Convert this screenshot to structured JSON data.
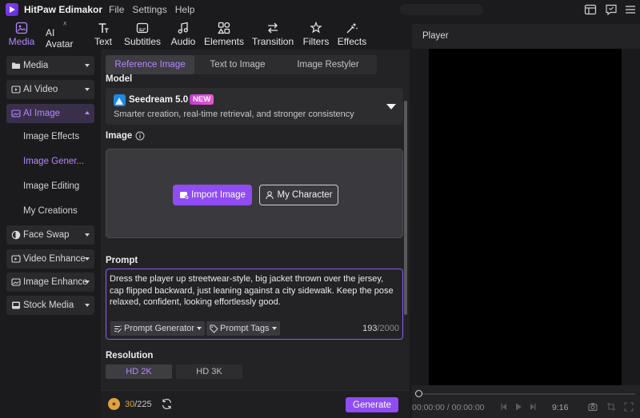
{
  "app": {
    "title": "HitPaw Edimakor",
    "menu": [
      "File",
      "Settings",
      "Help"
    ]
  },
  "tool_tabs": [
    {
      "label": "Media",
      "icon": "media-icon",
      "active": true
    },
    {
      "label": "AI Avatar",
      "icon": "avatar-icon",
      "active": false
    },
    {
      "label": "Text",
      "icon": "text-icon",
      "active": false
    },
    {
      "label": "Subtitles",
      "icon": "subtitles-icon",
      "active": false
    },
    {
      "label": "Audio",
      "icon": "audio-icon",
      "active": false
    },
    {
      "label": "Elements",
      "icon": "elements-icon",
      "active": false
    },
    {
      "label": "Transition",
      "icon": "transition-icon",
      "active": false
    },
    {
      "label": "Filters",
      "icon": "filters-icon",
      "active": false
    },
    {
      "label": "Effects",
      "icon": "effects-icon",
      "active": false
    }
  ],
  "sidebar": {
    "items": [
      {
        "label": "Media",
        "icon": "folder-icon"
      },
      {
        "label": "AI Video",
        "icon": "ai-video-icon"
      },
      {
        "label": "AI Image",
        "icon": "ai-image-icon"
      },
      {
        "label": "Face Swap",
        "icon": "face-swap-icon"
      },
      {
        "label": "Video Enhance",
        "icon": "video-enhance-icon"
      },
      {
        "label": "Image Enhance",
        "icon": "image-enhance-icon"
      },
      {
        "label": "Stock Media",
        "icon": "stock-media-icon"
      }
    ],
    "subitems": [
      "Image Effects",
      "Image Gener...",
      "Image Editing",
      "My Creations"
    ]
  },
  "main": {
    "subtabs": [
      "Reference Image",
      "Text to Image",
      "Image Restyler"
    ],
    "model_label": "Model",
    "model": {
      "name": "Seedream 5.0",
      "badge": "NEW",
      "description": "Smarter creation, real-time retrieval, and stronger consistency"
    },
    "image_label": "Image",
    "import_button": "Import Image",
    "character_button": "My Character",
    "prompt_label": "Prompt",
    "prompt_text": "Dress the player up streetwear-style, big jacket thrown over the jersey, cap flipped backward, just leaning against a city sidewalk. Keep the pose relaxed, confident, looking effortlessly good.",
    "prompt_generator": "Prompt Generator",
    "prompt_tags": "Prompt Tags",
    "char_count": "193",
    "char_max": "/2000",
    "resolution_label": "Resolution",
    "resolutions": [
      "HD 2K",
      "HD 3K"
    ],
    "credits_used": "30",
    "credits_total": "/225",
    "generate_button": "Generate"
  },
  "player": {
    "title": "Player",
    "timecode": "00:00:00 / 00:00:00",
    "aspect": "9:16"
  },
  "colors": {
    "accent": "#8f4cf2",
    "accent_text": "#b388ff",
    "credits": "#e0a340"
  }
}
